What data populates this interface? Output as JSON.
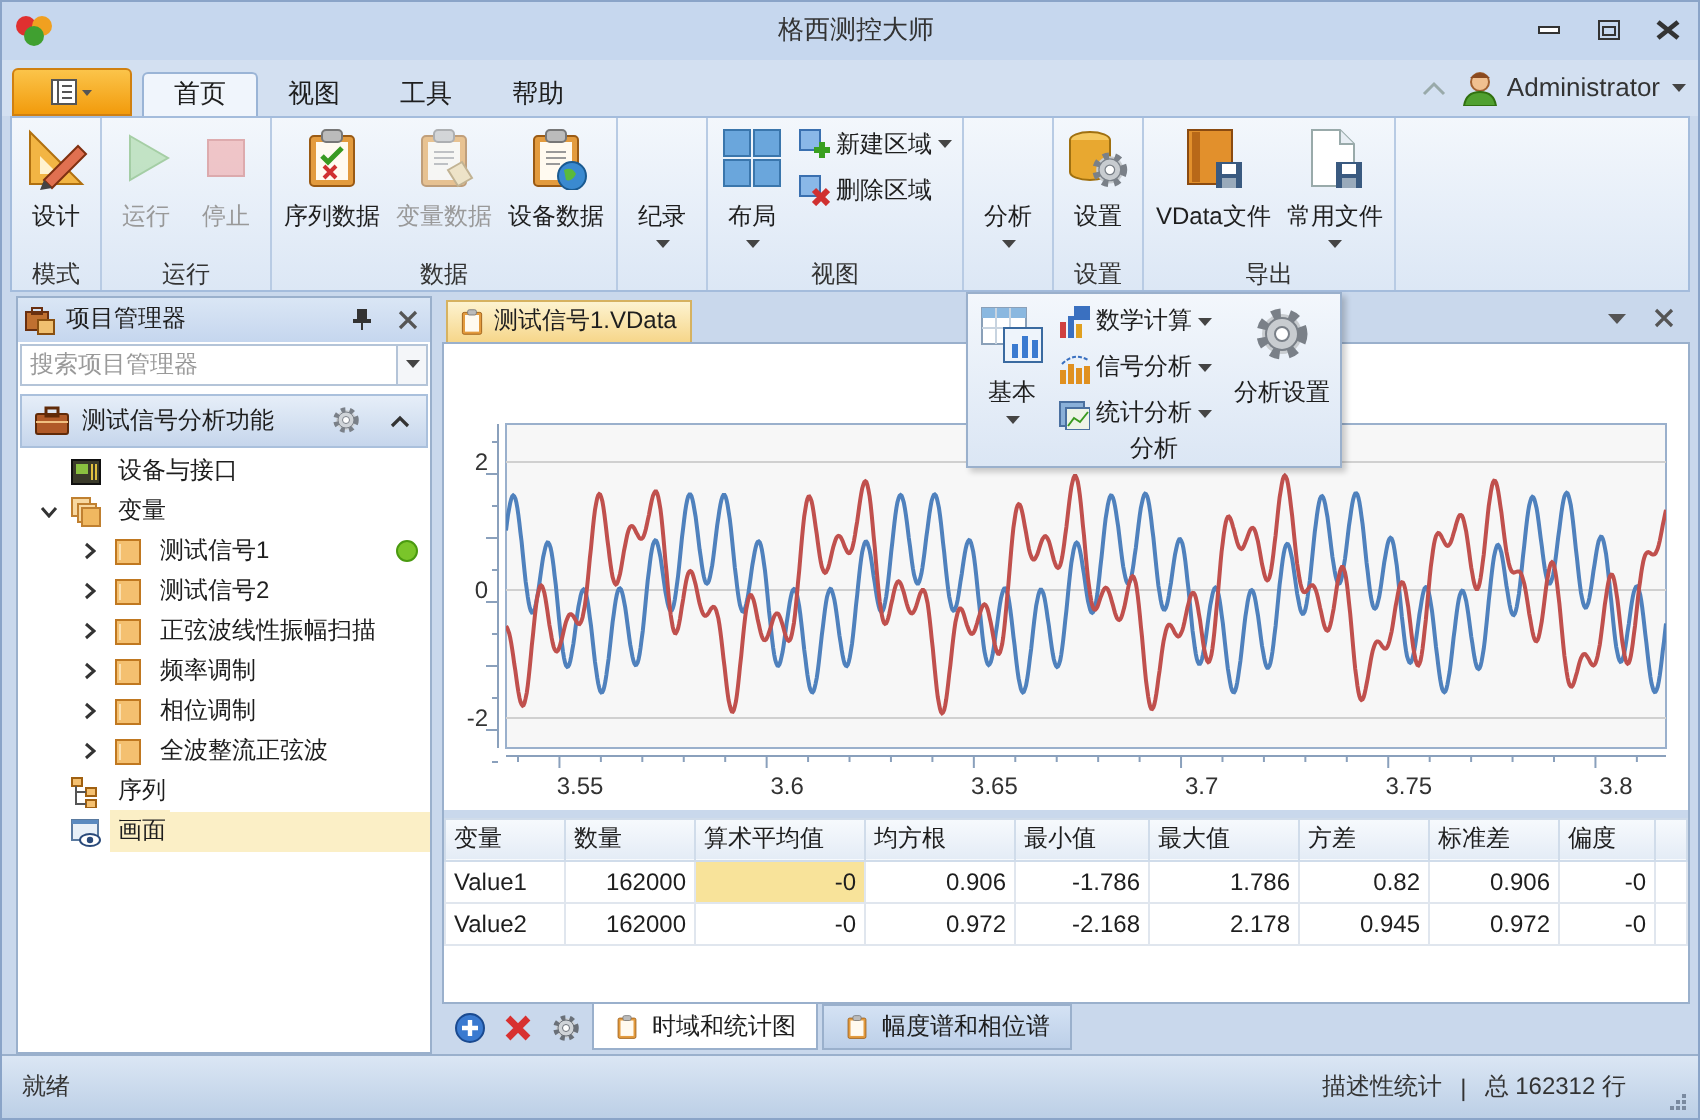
{
  "window": {
    "title": "格西测控大师"
  },
  "ribbon": {
    "tabs": [
      {
        "label": "首页",
        "selected": true
      },
      {
        "label": "视图",
        "selected": false
      },
      {
        "label": "工具",
        "selected": false
      },
      {
        "label": "帮助",
        "selected": false
      }
    ],
    "user": "Administrator",
    "groups": [
      {
        "label": "模式",
        "buttons": [
          {
            "label": "设计",
            "kind": "large",
            "disabled": false,
            "dropdown": false
          }
        ]
      },
      {
        "label": "运行",
        "buttons": [
          {
            "label": "运行",
            "kind": "large",
            "disabled": true,
            "dropdown": false
          },
          {
            "label": "停止",
            "kind": "large",
            "disabled": true,
            "dropdown": false
          }
        ]
      },
      {
        "label": "数据",
        "buttons": [
          {
            "label": "序列数据",
            "kind": "large",
            "disabled": false,
            "dropdown": false
          },
          {
            "label": "变量数据",
            "kind": "large",
            "disabled": true,
            "dropdown": false
          },
          {
            "label": "设备数据",
            "kind": "large",
            "disabled": false,
            "dropdown": false
          }
        ]
      },
      {
        "buttons": [
          {
            "label": "纪录",
            "kind": "large",
            "disabled": false,
            "dropdown": true
          }
        ]
      },
      {
        "label": "视图",
        "buttons": [
          {
            "label": "布局",
            "kind": "large",
            "disabled": false,
            "dropdown": true
          },
          {
            "label": "新建区域",
            "kind": "small",
            "disabled": false,
            "dropdown": true
          },
          {
            "label": "删除区域",
            "kind": "small",
            "disabled": false,
            "dropdown": false
          }
        ]
      },
      {
        "buttons": [
          {
            "label": "分析",
            "kind": "large",
            "disabled": false,
            "dropdown": true
          }
        ]
      },
      {
        "label": "设置",
        "buttons": [
          {
            "label": "设置",
            "kind": "large",
            "disabled": false,
            "dropdown": false
          }
        ]
      },
      {
        "label": "导出",
        "buttons": [
          {
            "label": "VData文件",
            "kind": "large",
            "disabled": false,
            "dropdown": false
          },
          {
            "label": "常用文件",
            "kind": "large",
            "disabled": false,
            "dropdown": true
          }
        ]
      }
    ]
  },
  "analysis_menu": {
    "label": "分析",
    "buttons": [
      {
        "label": "基本",
        "kind": "large",
        "dropdown": true
      },
      {
        "label": "数学计算",
        "kind": "small",
        "dropdown": true
      },
      {
        "label": "信号分析",
        "kind": "small",
        "dropdown": true
      },
      {
        "label": "统计分析",
        "kind": "small",
        "dropdown": true
      },
      {
        "label": "分析设置",
        "kind": "large",
        "dropdown": false
      }
    ]
  },
  "project_panel": {
    "title": "项目管理器",
    "search": {
      "placeholder": "搜索项目管理器"
    },
    "project": "测试信号分析功能",
    "tree": [
      {
        "label": "设备与接口",
        "kind": "device",
        "selected": false
      },
      {
        "label": "变量",
        "kind": "group",
        "selected": false,
        "expanded": true,
        "children": [
          {
            "label": "测试信号1",
            "kind": "variable",
            "selected": false,
            "expanded": false,
            "active": true
          },
          {
            "label": "测试信号2",
            "kind": "variable",
            "selected": false,
            "expanded": false,
            "active": false
          },
          {
            "label": "正弦波线性振幅扫描",
            "kind": "variable",
            "selected": false,
            "expanded": false,
            "active": false
          },
          {
            "label": "频率调制",
            "kind": "variable",
            "selected": false,
            "expanded": false,
            "active": false
          },
          {
            "label": "相位调制",
            "kind": "variable",
            "selected": false,
            "expanded": false,
            "active": false
          },
          {
            "label": "全波整流正弦波",
            "kind": "variable",
            "selected": false,
            "expanded": false,
            "active": false
          }
        ]
      },
      {
        "label": "序列",
        "kind": "sequence",
        "selected": false
      },
      {
        "label": "画面",
        "kind": "screen",
        "selected": true
      }
    ]
  },
  "document": {
    "tabs": [
      {
        "label": "测试信号1.VData",
        "selected": true
      }
    ],
    "chart": {
      "x_ticks": [
        "3.55",
        "3.6",
        "3.65",
        "3.7",
        "3.75",
        "3.8"
      ],
      "y_ticks": [
        "2",
        "0",
        "-2"
      ],
      "series": [
        {
          "color": "#4f81bd"
        },
        {
          "color": "#c0504d"
        }
      ]
    },
    "table": {
      "columns": [
        "变量",
        "数量",
        "算术平均值",
        "均方根",
        "最小值",
        "最大值",
        "方差",
        "标准差",
        "偏度"
      ],
      "rows": [
        {
          "cells": [
            {
              "text": "Value1",
              "selected": false
            },
            {
              "text": "162000",
              "selected": false
            },
            {
              "text": "-0",
              "selected": true
            },
            {
              "text": "0.906",
              "selected": false
            },
            {
              "text": "-1.786",
              "selected": false
            },
            {
              "text": "1.786",
              "selected": false
            },
            {
              "text": "0.82",
              "selected": false
            },
            {
              "text": "0.906",
              "selected": false
            },
            {
              "text": "-0",
              "selected": false
            }
          ]
        },
        {
          "cells": [
            {
              "text": "Value2",
              "selected": false
            },
            {
              "text": "162000",
              "selected": false
            },
            {
              "text": "-0",
              "selected": false
            },
            {
              "text": "0.972",
              "selected": false
            },
            {
              "text": "-2.168",
              "selected": false
            },
            {
              "text": "2.178",
              "selected": false
            },
            {
              "text": "0.945",
              "selected": false
            },
            {
              "text": "0.972",
              "selected": false
            },
            {
              "text": "-0",
              "selected": false
            }
          ]
        }
      ]
    },
    "bottom_tabs": [
      {
        "label": "时域和统计图",
        "selected": true
      },
      {
        "label": "幅度谱和相位谱",
        "selected": false
      }
    ]
  },
  "status_bar": {
    "message": "就绪",
    "mode": "描述性统计",
    "separator": "|",
    "total": "总 162312 行"
  }
}
